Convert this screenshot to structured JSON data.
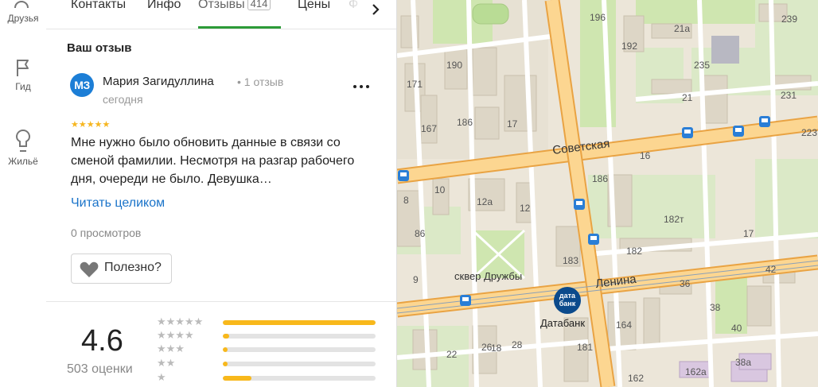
{
  "rail": {
    "items": [
      {
        "label": "Друзья",
        "icon": "friends-icon"
      },
      {
        "label": "Гид",
        "icon": "flag-icon"
      },
      {
        "label": "Жильё",
        "icon": "housing-icon"
      }
    ]
  },
  "tabs": {
    "items": [
      {
        "label": "Контакты"
      },
      {
        "label": "Инфо"
      },
      {
        "label": "Отзывы",
        "count": "414",
        "active": true
      },
      {
        "label": "Цены"
      },
      {
        "label": "Ф"
      }
    ],
    "next_icon": "chevron-right-icon"
  },
  "review": {
    "section_title": "Ваш отзыв",
    "avatar_initials": "МЗ",
    "avatar_color": "#1c7ed6",
    "author": "Мария Загидуллина",
    "author_reviews": "• 1 отзыв",
    "date": "сегодня",
    "stars": "★★★★★",
    "rating": 5,
    "text": "Мне нужно было обновить данные в связи со сменой фамилии. Несмотря на разгар рабочего дня, очереди не было. Девушка…",
    "read_more": "Читать целиком",
    "views": "0 просмотров",
    "useful_label": "Полезно?",
    "more_label": "..."
  },
  "summary": {
    "rating": "4.6",
    "count": "503 оценки",
    "distribution": [
      {
        "stars": "★★★★★",
        "fraction": 1.0
      },
      {
        "stars": "★★★★",
        "fraction": 0.04
      },
      {
        "stars": "★★★",
        "fraction": 0.03
      },
      {
        "stars": "★★",
        "fraction": 0.03
      },
      {
        "stars": "★",
        "fraction": 0.19
      }
    ],
    "bar_color": "#f8b81b"
  },
  "map": {
    "streets": [
      "Советская",
      "Ленина"
    ],
    "places": [
      "сквер Дружбы",
      "Датабанк"
    ],
    "bank_logo": "дата банк",
    "house_numbers": [
      "196",
      "239",
      "21а",
      "192",
      "190",
      "235",
      "171",
      "21",
      "231",
      "167",
      "186",
      "17",
      "223",
      "16",
      "186",
      "10",
      "12а",
      "12",
      "8",
      "182т",
      "86",
      "17",
      "183",
      "182",
      "9",
      "36",
      "42",
      "164",
      "38",
      "181",
      "40",
      "18",
      "22",
      "26",
      "28",
      "162",
      "162а",
      "38а"
    ]
  }
}
